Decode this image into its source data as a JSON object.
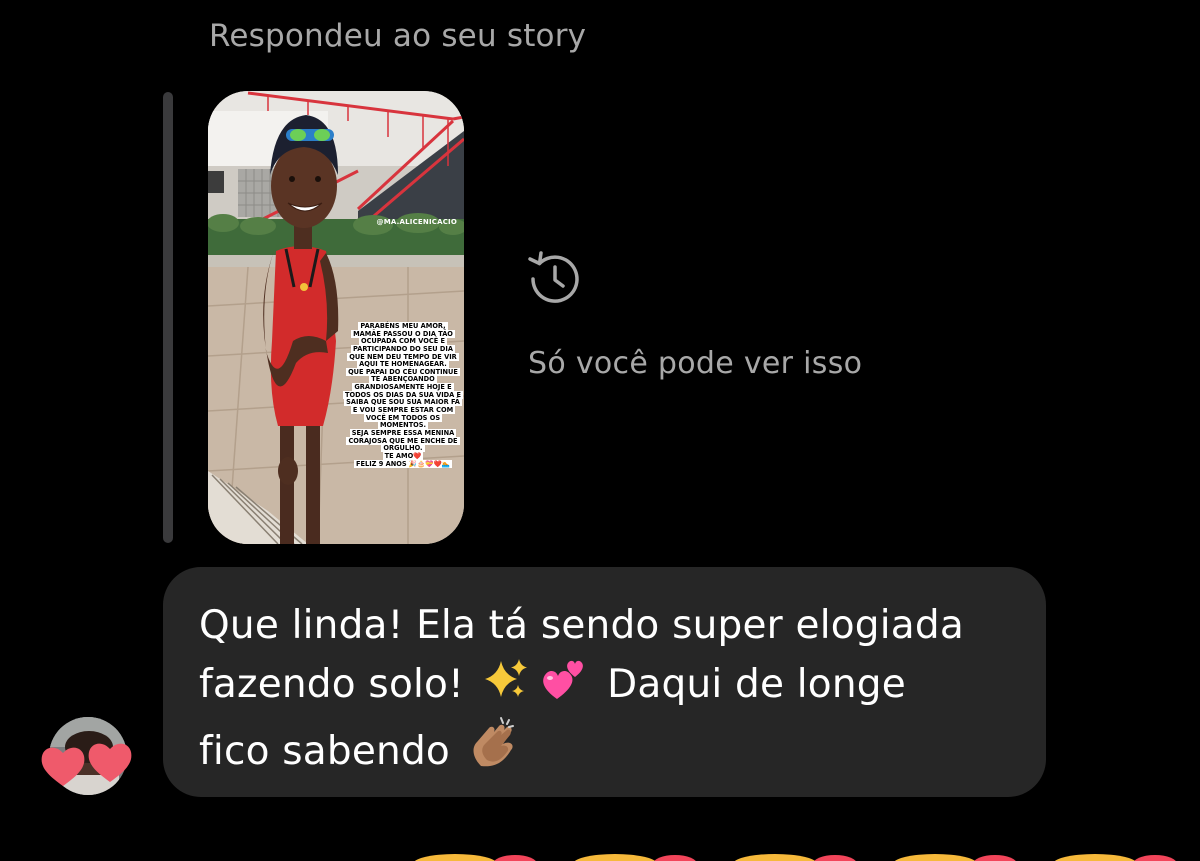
{
  "reply_context": {
    "label": "Respondeu ao seu story"
  },
  "story": {
    "handle": "@MA.ALICENICACIO",
    "caption_lines": [
      "PARABÉNS MEU AMOR,",
      "MAMÃE PASSOU O DIA TÃO",
      "OCUPADA COM VOCÊ E",
      "PARTICIPANDO DO SEU DIA",
      "QUE NEM DEU TEMPO DE VIR",
      "AQUI TE HOMENAGEAR.",
      "QUE PAPAI DO CÉU CONTINUE",
      "TE ABENÇOANDO",
      "GRANDIOSAMENTE HOJE E",
      "TODOS OS DIAS DA SUA VIDA E",
      "SAIBA QUE SOU SUA MAIOR FÃ",
      "E VOU SEMPRE ESTAR COM",
      "VOCÊ EM TODOS OS",
      "MOMENTOS.",
      "SEJA SEMPRE ESSA MENINA",
      "CORAJOSA QUE ME ENCHE DE",
      "ORGULHO.",
      "TE AMO❤️",
      "FELIZ 9 ANOS 🎉🎂💝❤️🏊"
    ]
  },
  "expired_notice": {
    "icon": "history-icon",
    "text": "Só você pode ver isso"
  },
  "message": {
    "line1": "Que linda! Ela tá sendo super elogiada",
    "line2_start": "fazendo solo!",
    "line2_emoji1": "✨",
    "line2_emoji2": "💕",
    "line2_end": "Daqui de longe",
    "line3": "fico sabendo",
    "line3_emoji": "👏🏽"
  },
  "sender": {
    "avatar_icon": "avatar",
    "sticker_icon": "heart-icon"
  },
  "colors": {
    "background": "#000000",
    "bubble": "#262626",
    "secondary_text": "#a8a8a8",
    "quote_bar": "#3a3a3c",
    "heart": "#ef5a6b"
  }
}
